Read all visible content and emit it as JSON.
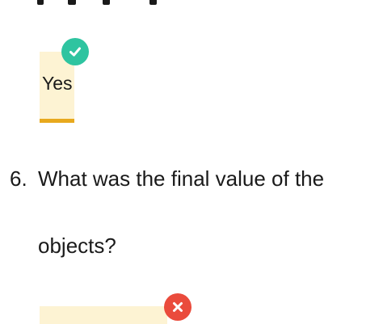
{
  "previous_question": {
    "answer_text": "Yes",
    "result_icon": "check-icon",
    "colors": {
      "answer_background": "#fdf3d3",
      "answer_underline": "#e8a91e",
      "correct_badge": "#2ec4a0"
    }
  },
  "question": {
    "number": "6.",
    "text_line1": "What was the final value of the",
    "text_line2": "objects?",
    "answer_value": "",
    "result_icon": "close-icon",
    "colors": {
      "input_background": "#fdf3d3",
      "wrong_badge": "#ea4b3c"
    }
  }
}
